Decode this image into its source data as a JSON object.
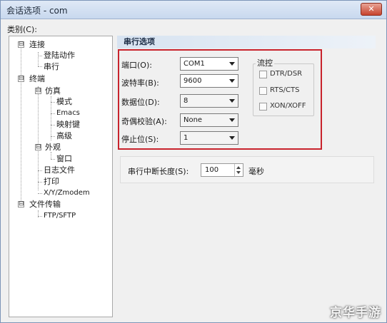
{
  "window": {
    "title": "会话选项 - com",
    "close_label": "✕"
  },
  "sidebar": {
    "label": "类别(C):",
    "items": [
      {
        "label": "连接",
        "expander": "⊟"
      },
      {
        "label": "登陆动作"
      },
      {
        "label": "串行"
      },
      {
        "label": "终端",
        "expander": "⊟"
      },
      {
        "label": "仿真",
        "expander": "⊟"
      },
      {
        "label": "模式"
      },
      {
        "label": "Emacs"
      },
      {
        "label": "映射键"
      },
      {
        "label": "高级"
      },
      {
        "label": "外观",
        "expander": "⊟"
      },
      {
        "label": "窗口"
      },
      {
        "label": "日志文件"
      },
      {
        "label": "打印"
      },
      {
        "label": "X/Y/Zmodem"
      },
      {
        "label": "文件传输",
        "expander": "⊟"
      },
      {
        "label": "FTP/SFTP"
      }
    ]
  },
  "serial": {
    "header": "串行选项",
    "port": {
      "label": "端口(O):",
      "value": "COM1"
    },
    "baud": {
      "label": "波特率(B):",
      "value": "9600"
    },
    "databits": {
      "label": "数据位(D):",
      "value": "8"
    },
    "parity": {
      "label": "奇偶校验(A):",
      "value": "None"
    },
    "stopbits": {
      "label": "停止位(S):",
      "value": "1"
    },
    "flow": {
      "title": "流控",
      "dtr": "DTR/DSR",
      "rts": "RTS/CTS",
      "xon": "XON/XOFF"
    },
    "delay": {
      "label": "串行中断长度(S):",
      "value": "100",
      "unit": "毫秒"
    }
  },
  "watermark": "京华手游"
}
